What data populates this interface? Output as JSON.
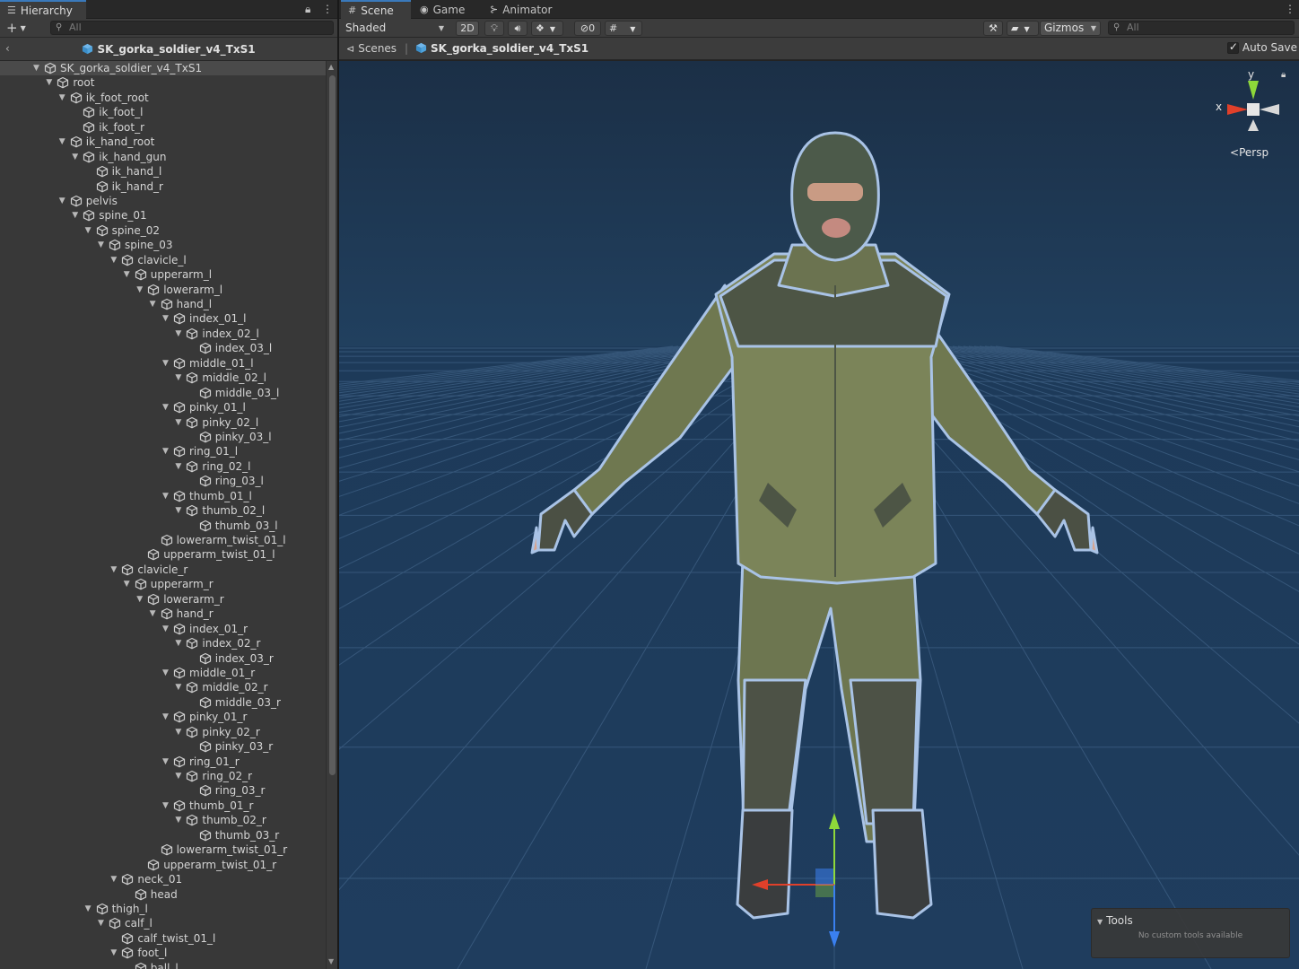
{
  "hierarchy": {
    "tab_label": "Hierarchy",
    "add_label": "+",
    "search_placeholder": "All",
    "header_title": "SK_gorka_soldier_v4_TxS1",
    "tree": [
      {
        "label": "SK_gorka_soldier_v4_TxS1",
        "depth": 0,
        "arrow": true,
        "root": true
      },
      {
        "label": "root",
        "depth": 1,
        "arrow": true
      },
      {
        "label": "ik_foot_root",
        "depth": 2,
        "arrow": true
      },
      {
        "label": "ik_foot_l",
        "depth": 3,
        "arrow": false
      },
      {
        "label": "ik_foot_r",
        "depth": 3,
        "arrow": false
      },
      {
        "label": "ik_hand_root",
        "depth": 2,
        "arrow": true
      },
      {
        "label": "ik_hand_gun",
        "depth": 3,
        "arrow": true
      },
      {
        "label": "ik_hand_l",
        "depth": 4,
        "arrow": false
      },
      {
        "label": "ik_hand_r",
        "depth": 4,
        "arrow": false
      },
      {
        "label": "pelvis",
        "depth": 2,
        "arrow": true
      },
      {
        "label": "spine_01",
        "depth": 3,
        "arrow": true
      },
      {
        "label": "spine_02",
        "depth": 4,
        "arrow": true
      },
      {
        "label": "spine_03",
        "depth": 5,
        "arrow": true
      },
      {
        "label": "clavicle_l",
        "depth": 6,
        "arrow": true
      },
      {
        "label": "upperarm_l",
        "depth": 7,
        "arrow": true
      },
      {
        "label": "lowerarm_l",
        "depth": 8,
        "arrow": true
      },
      {
        "label": "hand_l",
        "depth": 9,
        "arrow": true
      },
      {
        "label": "index_01_l",
        "depth": 10,
        "arrow": true
      },
      {
        "label": "index_02_l",
        "depth": 11,
        "arrow": true
      },
      {
        "label": "index_03_l",
        "depth": 12,
        "arrow": false
      },
      {
        "label": "middle_01_l",
        "depth": 10,
        "arrow": true
      },
      {
        "label": "middle_02_l",
        "depth": 11,
        "arrow": true
      },
      {
        "label": "middle_03_l",
        "depth": 12,
        "arrow": false
      },
      {
        "label": "pinky_01_l",
        "depth": 10,
        "arrow": true
      },
      {
        "label": "pinky_02_l",
        "depth": 11,
        "arrow": true
      },
      {
        "label": "pinky_03_l",
        "depth": 12,
        "arrow": false
      },
      {
        "label": "ring_01_l",
        "depth": 10,
        "arrow": true
      },
      {
        "label": "ring_02_l",
        "depth": 11,
        "arrow": true
      },
      {
        "label": "ring_03_l",
        "depth": 12,
        "arrow": false
      },
      {
        "label": "thumb_01_l",
        "depth": 10,
        "arrow": true
      },
      {
        "label": "thumb_02_l",
        "depth": 11,
        "arrow": true
      },
      {
        "label": "thumb_03_l",
        "depth": 12,
        "arrow": false
      },
      {
        "label": "lowerarm_twist_01_l",
        "depth": 9,
        "arrow": false
      },
      {
        "label": "upperarm_twist_01_l",
        "depth": 8,
        "arrow": false
      },
      {
        "label": "clavicle_r",
        "depth": 6,
        "arrow": true
      },
      {
        "label": "upperarm_r",
        "depth": 7,
        "arrow": true
      },
      {
        "label": "lowerarm_r",
        "depth": 8,
        "arrow": true
      },
      {
        "label": "hand_r",
        "depth": 9,
        "arrow": true
      },
      {
        "label": "index_01_r",
        "depth": 10,
        "arrow": true
      },
      {
        "label": "index_02_r",
        "depth": 11,
        "arrow": true
      },
      {
        "label": "index_03_r",
        "depth": 12,
        "arrow": false
      },
      {
        "label": "middle_01_r",
        "depth": 10,
        "arrow": true
      },
      {
        "label": "middle_02_r",
        "depth": 11,
        "arrow": true
      },
      {
        "label": "middle_03_r",
        "depth": 12,
        "arrow": false
      },
      {
        "label": "pinky_01_r",
        "depth": 10,
        "arrow": true
      },
      {
        "label": "pinky_02_r",
        "depth": 11,
        "arrow": true
      },
      {
        "label": "pinky_03_r",
        "depth": 12,
        "arrow": false
      },
      {
        "label": "ring_01_r",
        "depth": 10,
        "arrow": true
      },
      {
        "label": "ring_02_r",
        "depth": 11,
        "arrow": true
      },
      {
        "label": "ring_03_r",
        "depth": 12,
        "arrow": false
      },
      {
        "label": "thumb_01_r",
        "depth": 10,
        "arrow": true
      },
      {
        "label": "thumb_02_r",
        "depth": 11,
        "arrow": true
      },
      {
        "label": "thumb_03_r",
        "depth": 12,
        "arrow": false
      },
      {
        "label": "lowerarm_twist_01_r",
        "depth": 9,
        "arrow": false
      },
      {
        "label": "upperarm_twist_01_r",
        "depth": 8,
        "arrow": false
      },
      {
        "label": "neck_01",
        "depth": 6,
        "arrow": true
      },
      {
        "label": "head",
        "depth": 7,
        "arrow": false
      },
      {
        "label": "thigh_l",
        "depth": 4,
        "arrow": true
      },
      {
        "label": "calf_l",
        "depth": 5,
        "arrow": true
      },
      {
        "label": "calf_twist_01_l",
        "depth": 6,
        "arrow": false
      },
      {
        "label": "foot_l",
        "depth": 6,
        "arrow": true
      },
      {
        "label": "ball_l",
        "depth": 7,
        "arrow": false
      }
    ]
  },
  "scene": {
    "tabs": [
      {
        "label": "Scene",
        "icon": "grid-icon"
      },
      {
        "label": "Game",
        "icon": "gamepad-icon"
      },
      {
        "label": "Animator",
        "icon": "animator-icon"
      }
    ],
    "shading_mode": "Shaded",
    "toggle_2d": "2D",
    "hidden_count": "0",
    "gizmos_label": "Gizmos",
    "search_placeholder": "All",
    "breadcrumb_scenes": "Scenes",
    "breadcrumb_prefab": "SK_gorka_soldier_v4_TxS1",
    "auto_save_label": "Auto Save",
    "auto_save_checked": true,
    "orientation": {
      "y_label": "y",
      "x_label": "x",
      "projection_label": "Persp"
    },
    "tools_overlay": {
      "title": "Tools",
      "message": "No custom tools available"
    },
    "colors": {
      "sky_top": "#1c3047",
      "floor": "#1e3a5a",
      "grid_line": "#4a6d93",
      "axis_x": "#e0402a",
      "axis_y": "#8ed83a",
      "axis_z": "#3a80f0",
      "jacket": "#7b8459",
      "jacket_dark": "#4d5545",
      "selection_outline": "#a9c3e6"
    }
  }
}
